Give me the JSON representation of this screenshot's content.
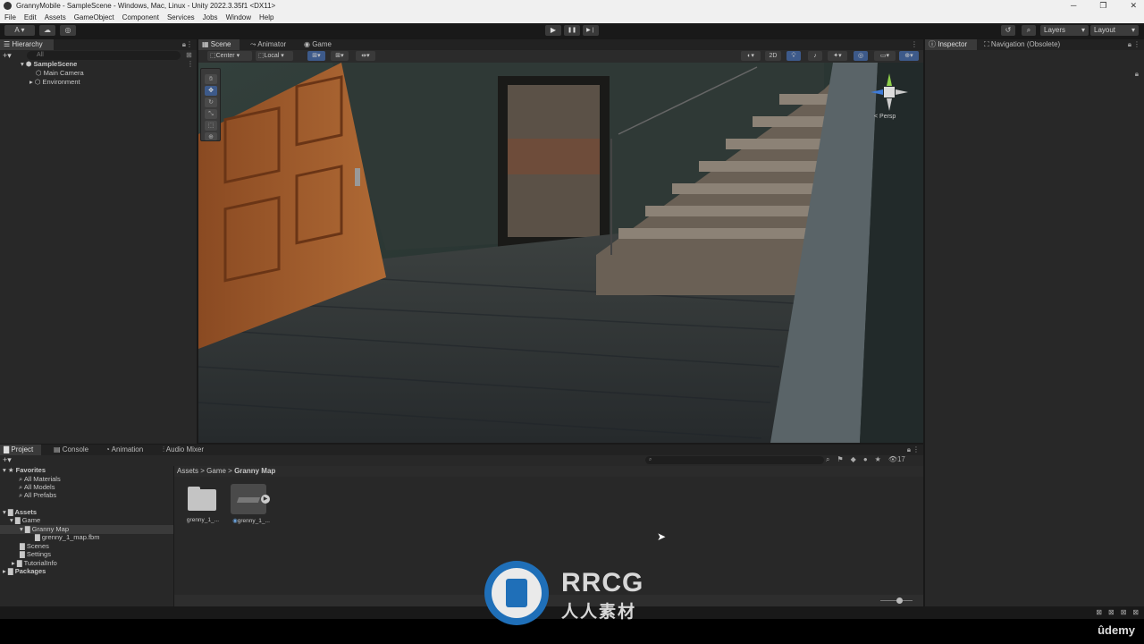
{
  "window": {
    "title": "GrannyMobile - SampleScene - Windows, Mac, Linux - Unity 2022.3.35f1 <DX11>",
    "minimize": "─",
    "maximize": "❐",
    "close": "✕"
  },
  "menu": [
    "File",
    "Edit",
    "Assets",
    "GameObject",
    "Component",
    "Services",
    "Jobs",
    "Window",
    "Help"
  ],
  "toolbar": {
    "account": "A ▾",
    "layers": "Layers",
    "layout": "Layout",
    "play_icon": "▶",
    "pause_icon": "❚❚",
    "step_icon": "▶❘"
  },
  "hierarchy": {
    "tab": "Hierarchy",
    "search_placeholder": "All",
    "scene": "SampleScene",
    "items": [
      "Main Camera",
      "Environment"
    ]
  },
  "scene_tabs": [
    "Scene",
    "Animator",
    "Game"
  ],
  "scene_toolbar": {
    "pivot": "Center",
    "space": "Local",
    "mode_2d": "2D",
    "persp": "< Persp"
  },
  "inspector_tabs": [
    "Inspector",
    "Navigation (Obsolete)"
  ],
  "bottom_tabs": [
    "Project",
    "Console",
    "Animation",
    "Audio Mixer"
  ],
  "project": {
    "favorites_label": "Favorites",
    "favorites": [
      "All Materials",
      "All Models",
      "All Prefabs"
    ],
    "assets_label": "Assets",
    "tree": [
      {
        "label": "Game",
        "depth": 1
      },
      {
        "label": "Granny Map",
        "depth": 2
      },
      {
        "label": "grenny_1_map.fbm",
        "depth": 3
      },
      {
        "label": "Scenes",
        "depth": 1
      },
      {
        "label": "Settings",
        "depth": 1
      },
      {
        "label": "TutorialInfo",
        "depth": 1
      }
    ],
    "packages_label": "Packages",
    "breadcrumb": [
      "Assets",
      "Game",
      "Granny Map"
    ],
    "hidden_count": "17",
    "files": [
      {
        "name": "grenny_1_...",
        "kind": "folder"
      },
      {
        "name": "grenny_1_...",
        "kind": "model"
      }
    ]
  },
  "watermark": {
    "brand": "RRCG",
    "subtitle": "人人素材",
    "udemy": "ûdemy"
  }
}
